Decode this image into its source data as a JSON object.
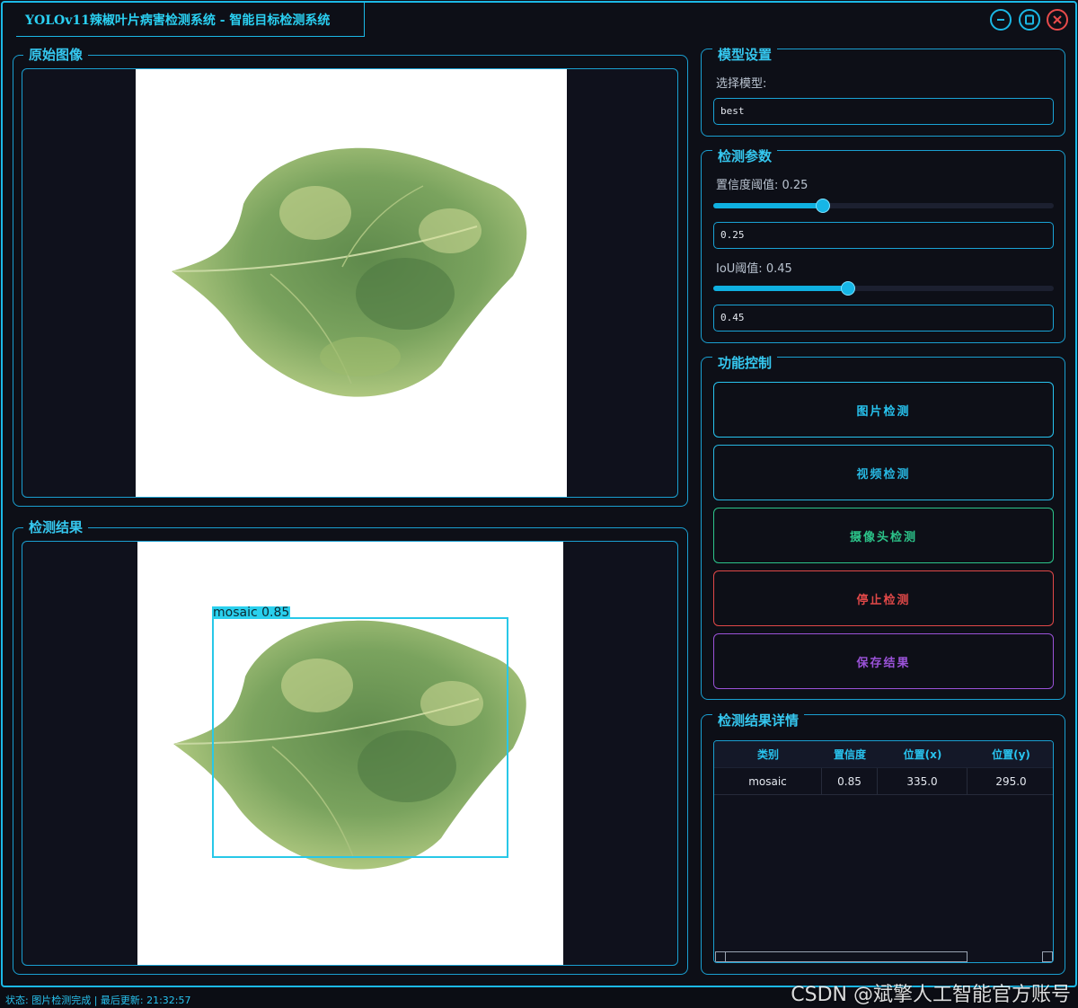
{
  "window": {
    "title": "YOLOv11辣椒叶片病害检测系统 - 智能目标检测系统",
    "minimize_icon": "minimize-icon",
    "maximize_icon": "maximize-icon",
    "close_icon": "close-icon"
  },
  "original_panel": {
    "title": "原始图像"
  },
  "result_panel": {
    "title": "检测结果",
    "detection_label": "mosaic 0.85",
    "box_color": "#28c8e8"
  },
  "model_settings": {
    "title": "模型设置",
    "select_label": "选择模型:",
    "model_value": "best"
  },
  "detection_params": {
    "title": "检测参数",
    "conf_label": "置信度阈值: 0.25",
    "conf_value": 0.25,
    "conf_input": "0.25",
    "iou_label": "IoU阈值: 0.45",
    "iou_value": 0.45,
    "iou_input": "0.45"
  },
  "function_control": {
    "title": "功能控制",
    "buttons": [
      {
        "label": "图片检测",
        "color": "#27c3ef"
      },
      {
        "label": "视频检测",
        "color": "#27b6e0"
      },
      {
        "label": "摄像头检测",
        "color": "#2cc48a"
      },
      {
        "label": "停止检测",
        "color": "#e04848"
      },
      {
        "label": "保存结果",
        "color": "#9a52d8"
      }
    ]
  },
  "results_table": {
    "title": "检测结果详情",
    "headers": [
      "类别",
      "置信度",
      "位置(x)",
      "位置(y)"
    ],
    "rows": [
      [
        "mosaic",
        "0.85",
        "335.0",
        "295.0"
      ]
    ]
  },
  "status_bar": {
    "text": "状态: 图片检测完成 | 最后更新: 21:32:57"
  },
  "watermark": {
    "text": "CSDN @斌擎人工智能官方账号"
  },
  "colors": {
    "accent": "#1bb8e6",
    "background": "#0d0f17"
  }
}
